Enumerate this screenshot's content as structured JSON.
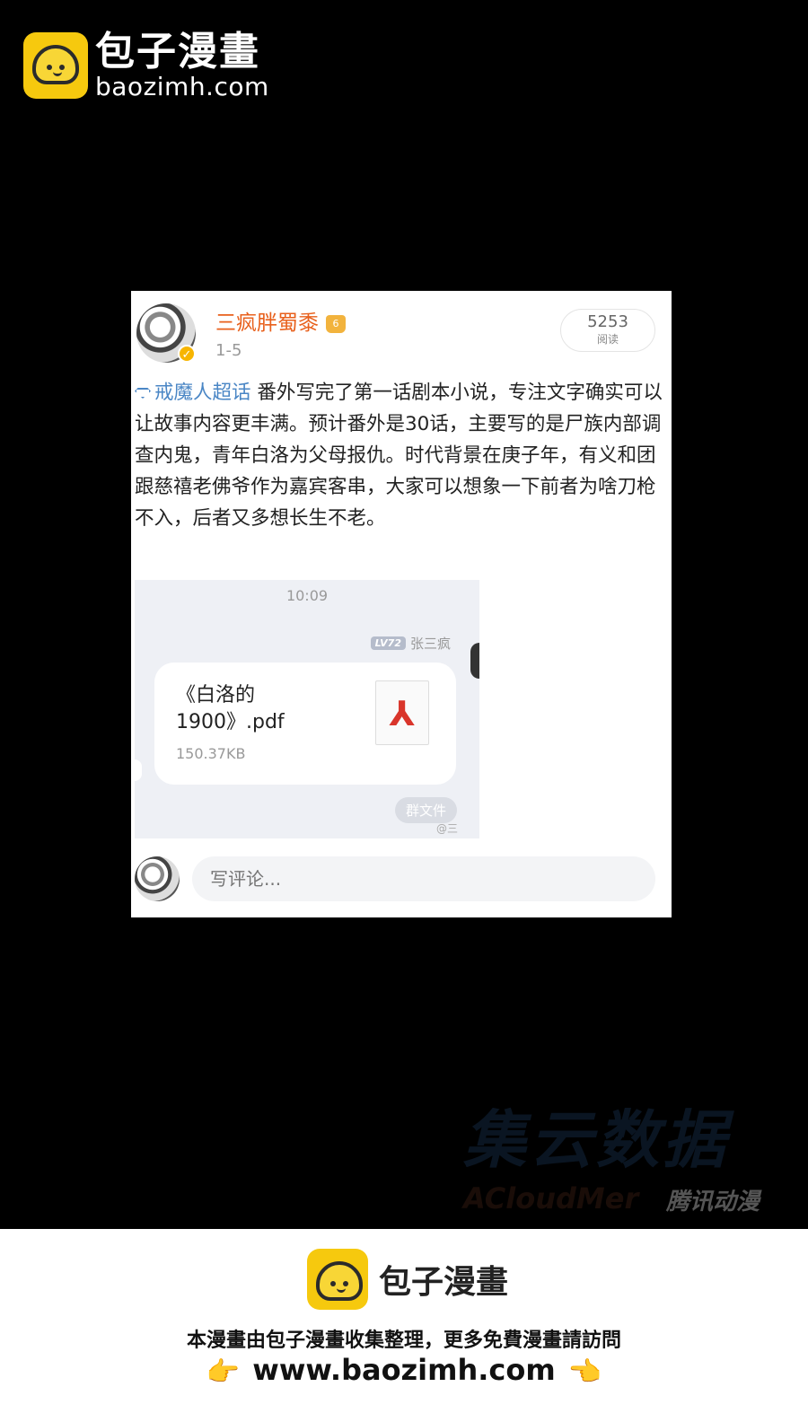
{
  "watermark_top": {
    "cn": "包子漫畫",
    "en": "baozimh.com",
    "icon": "bun-logo-icon"
  },
  "post": {
    "username": "三疯胖蜀黍",
    "badge_icon": "crown-icon",
    "date": "1-5",
    "reads_count": "5253",
    "reads_label": "阅读",
    "topic": "戒魔人超话",
    "body": " 番外写完了第一话剧本小说，专注文字确实可以让故事内容更丰满。预计番外是30话，主要写的是尸族内部调查内鬼，青年白洛为父母报仇。时代背景在庚子年，有义和团跟慈禧老佛爷作为嘉宾客串，大家可以想象一下前者为啥刀枪不入，后者又多想长生不老。"
  },
  "chat": {
    "time": "10:09",
    "level": "LV72",
    "sender": "张三疯",
    "file_name": "《白洛的1900》.pdf",
    "file_size": "150.37KB",
    "file_icon": "pdf-icon",
    "group_files_label": "群文件",
    "weibo_mark": "@三"
  },
  "comment": {
    "placeholder": "写评论..."
  },
  "faint_watermark": {
    "big": "集云数据",
    "small": "ACloudMer",
    "tag": "腾讯动漫"
  },
  "banner": {
    "brand": "包子漫畫",
    "note": "本漫畫由包子漫畫收集整理，更多免費漫畫請訪問",
    "url": "www.baozimh.com",
    "left_hand": "👉",
    "right_hand": "👈"
  }
}
